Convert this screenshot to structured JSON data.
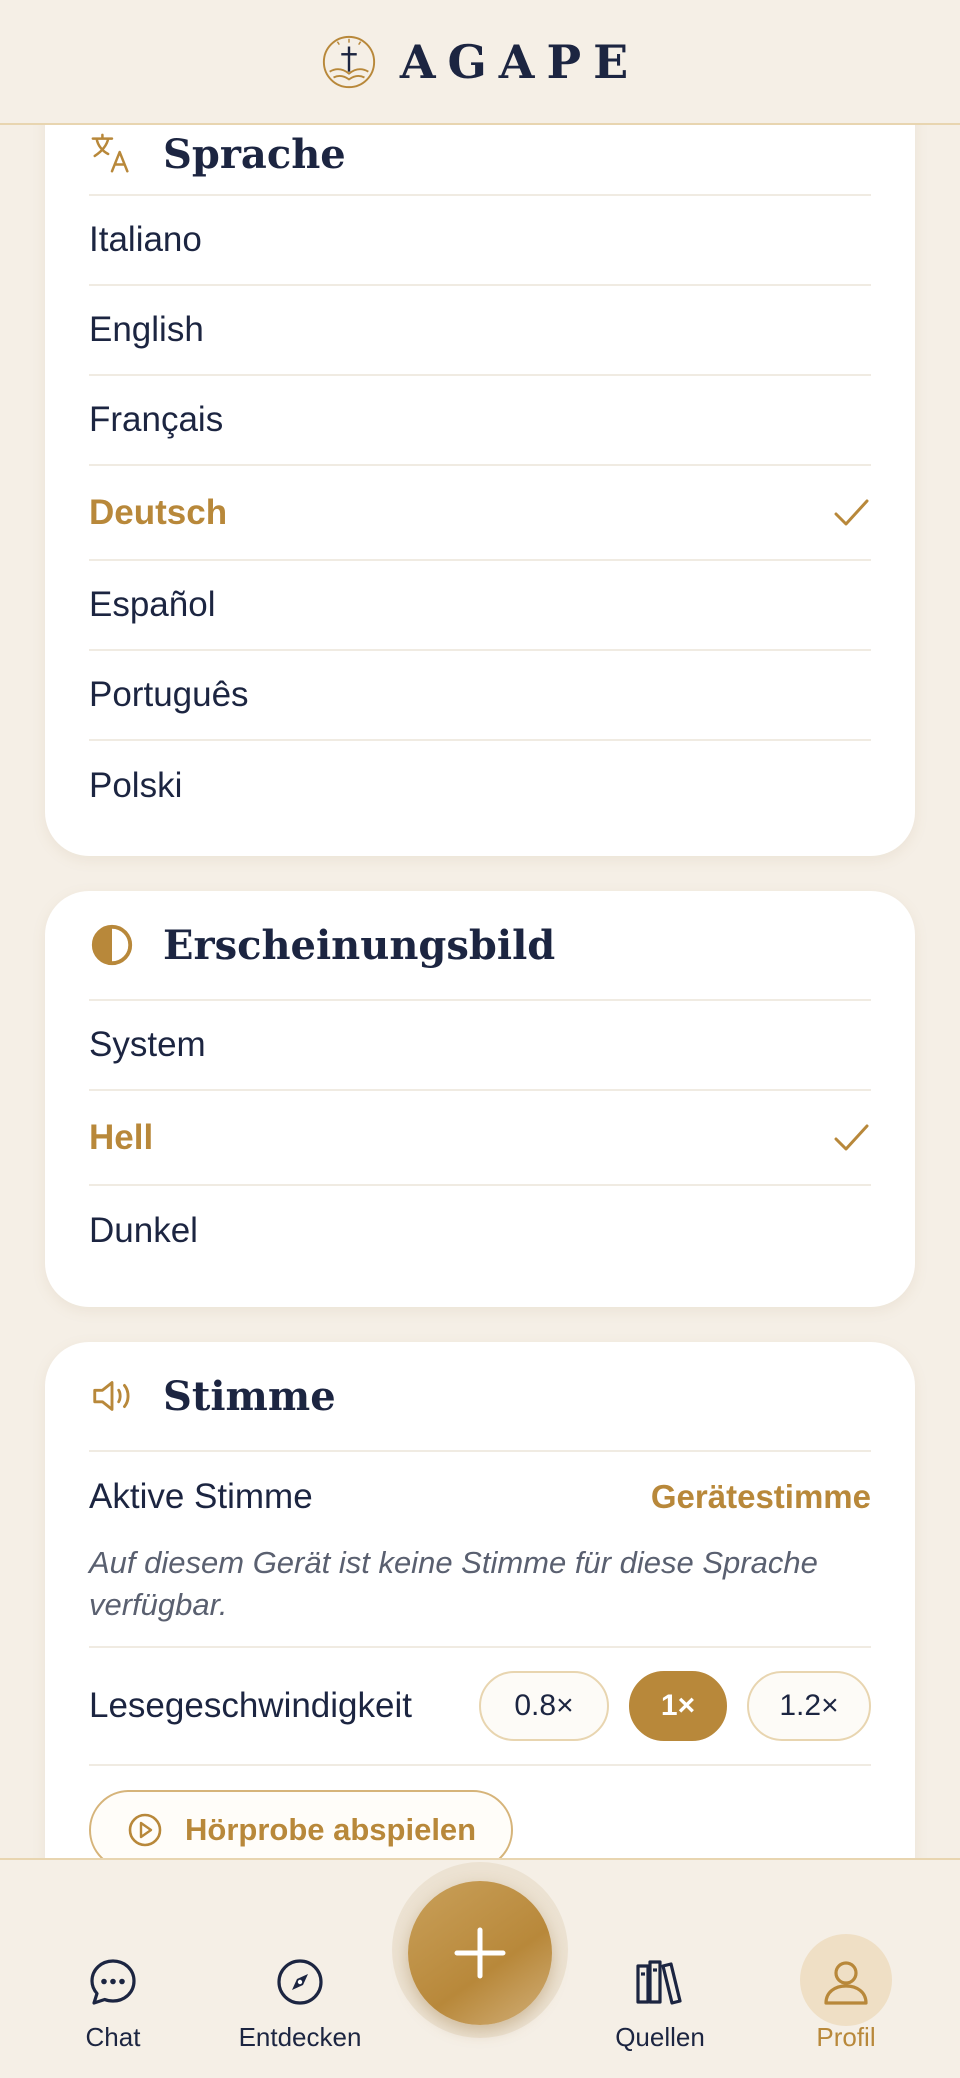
{
  "header": {
    "brand": "AGAPE"
  },
  "language": {
    "title": "Sprache",
    "options": [
      {
        "label": "Italiano"
      },
      {
        "label": "English"
      },
      {
        "label": "Français"
      },
      {
        "label": "Deutsch",
        "selected": true
      },
      {
        "label": "Español"
      },
      {
        "label": "Português"
      },
      {
        "label": "Polski"
      }
    ]
  },
  "appearance": {
    "title": "Erscheinungsbild",
    "options": [
      {
        "label": "System"
      },
      {
        "label": "Hell",
        "selected": true
      },
      {
        "label": "Dunkel"
      }
    ]
  },
  "voice": {
    "title": "Stimme",
    "active_label": "Aktive Stimme",
    "active_value": "Gerätestimme",
    "note": "Auf diesem Gerät ist keine Stimme für diese Sprache verfügbar.",
    "speed_label": "Lesegeschwindigkeit",
    "speeds": [
      "0.8×",
      "1×",
      "1.2×"
    ],
    "selected_speed": "1×",
    "play_label": "Hörprobe abspielen"
  },
  "tabbar": {
    "chat": "Chat",
    "discover": "Entdecken",
    "sources": "Quellen",
    "profile": "Profil",
    "active": "Profil"
  },
  "colors": {
    "accent": "#b8883a",
    "text": "#1c2541",
    "background": "#f5efe6"
  }
}
